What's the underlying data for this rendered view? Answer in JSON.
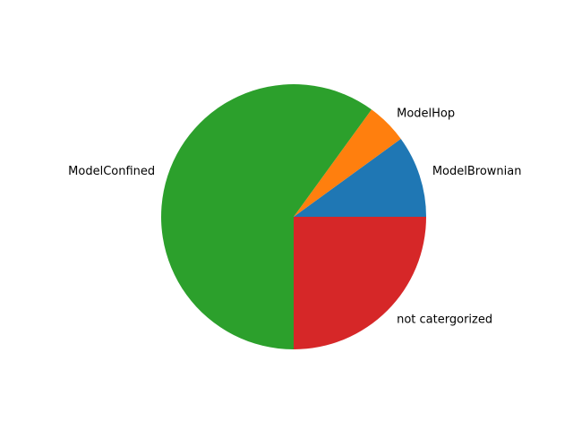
{
  "chart_data": {
    "type": "pie",
    "title": "",
    "start_angle_deg": 0,
    "direction": "counterclockwise",
    "slices": [
      {
        "label": "ModelBrownian",
        "value": 10,
        "color": "#1f77b4"
      },
      {
        "label": "ModelHop",
        "value": 5,
        "color": "#ff7f0e"
      },
      {
        "label": "ModelConfined",
        "value": 60,
        "color": "#2ca02c"
      },
      {
        "label": "not catergorized",
        "value": 25,
        "color": "#d62728"
      }
    ]
  }
}
